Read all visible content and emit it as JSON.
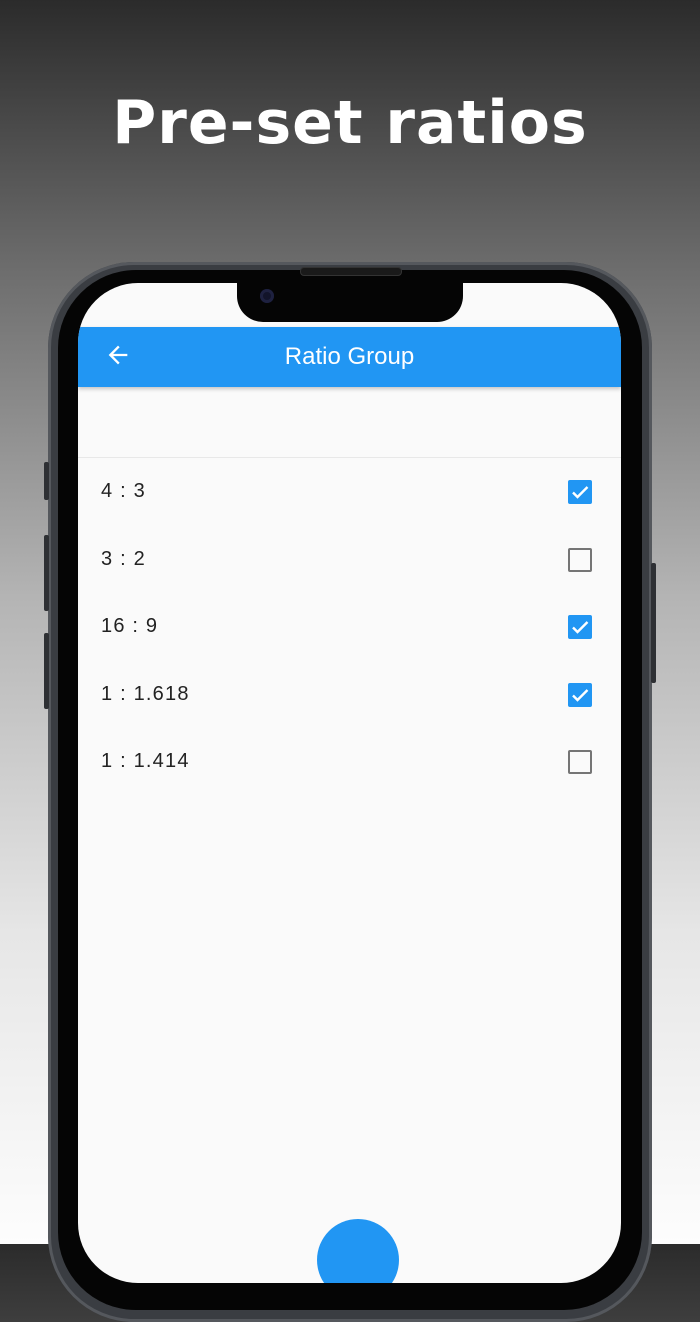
{
  "promo": {
    "headline": "Pre-set ratios"
  },
  "app_bar": {
    "title": "Ratio Group",
    "back_icon": "arrow-left-icon",
    "color": "#2196f3"
  },
  "ratios": [
    {
      "label": "4 : 3",
      "checked": true
    },
    {
      "label": "3 : 2",
      "checked": false
    },
    {
      "label": "16 : 9",
      "checked": true
    },
    {
      "label": "1 : 1.618",
      "checked": true
    },
    {
      "label": "1 : 1.414",
      "checked": false
    }
  ],
  "fab": {
    "icon": "add-icon",
    "color": "#2196f3"
  }
}
